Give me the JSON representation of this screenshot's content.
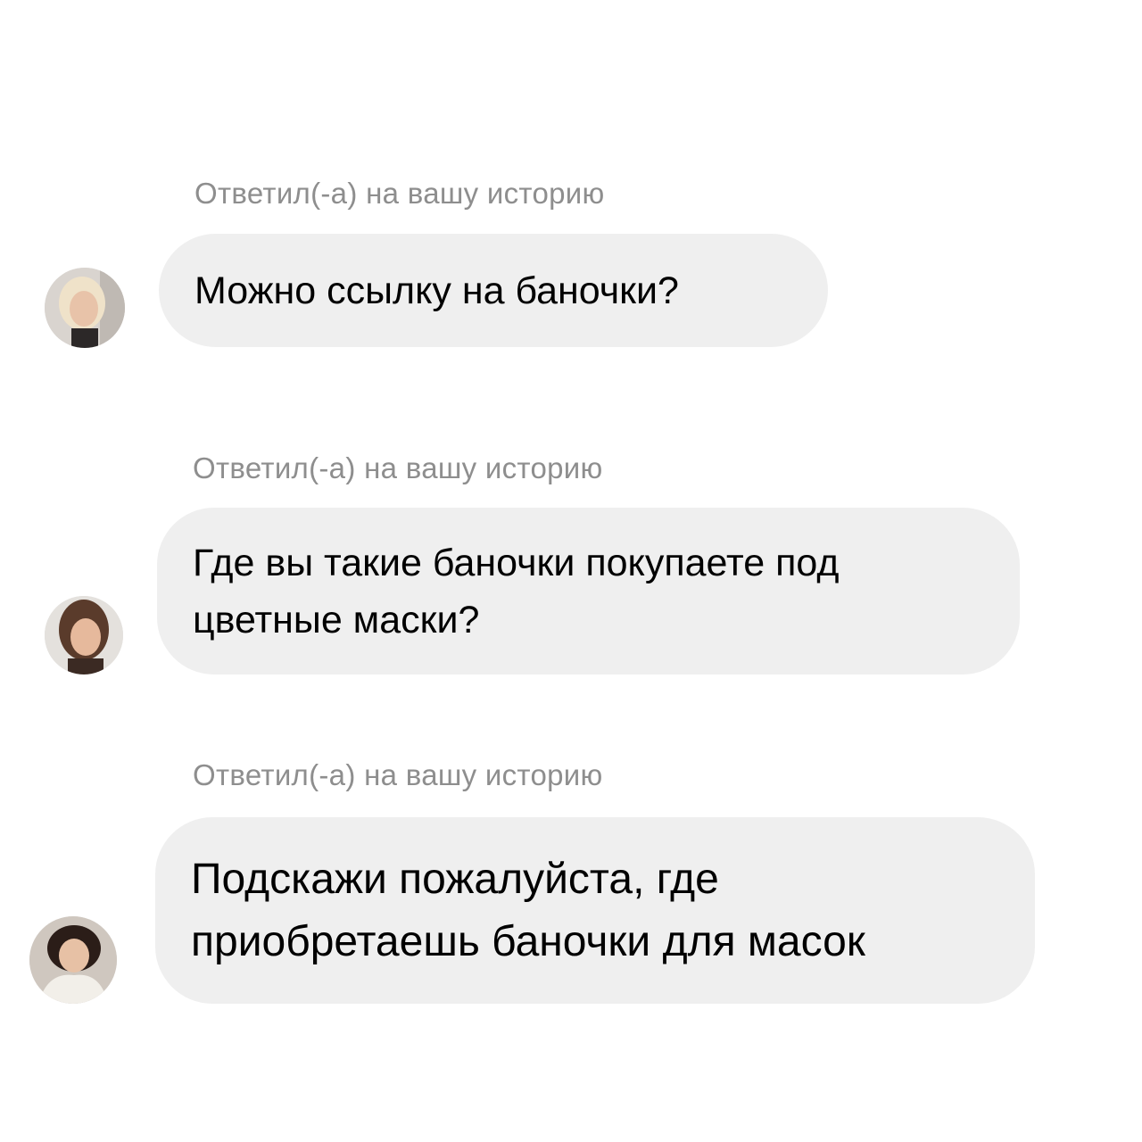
{
  "messages": [
    {
      "caption": "Ответил(-а) на вашу историю",
      "avatar_icon": "user-photo-blonde-icon",
      "lines": [
        "Можно ссылку на баночки?"
      ]
    },
    {
      "caption": "Ответил(-а) на вашу историю",
      "avatar_icon": "user-photo-brunette-icon",
      "lines": [
        "Где вы такие баночки покупаете под",
        "цветные маски?"
      ]
    },
    {
      "caption": "Ответил(-а) на вашу историю",
      "avatar_icon": "user-photo-darkhair-icon",
      "lines": [
        "Подскажи пожалуйста, где",
        "приобретаешь баночки для масок"
      ]
    }
  ],
  "colors": {
    "bubble": "#efefef",
    "caption": "#8e8e8e",
    "text": "#000000",
    "background": "#ffffff"
  }
}
